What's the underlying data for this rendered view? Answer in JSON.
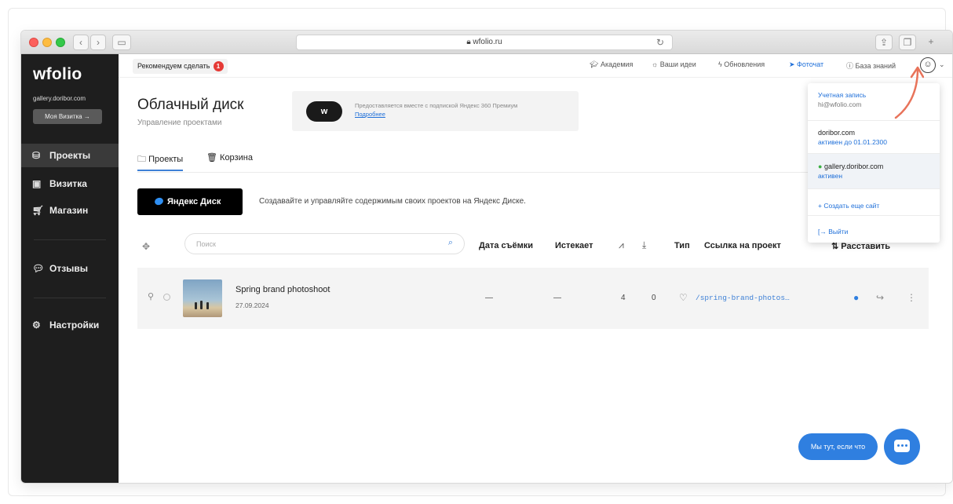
{
  "browser": {
    "url": "wfolio.ru",
    "lock_icon": "lock-icon",
    "nav_back": "‹",
    "nav_forward": "›"
  },
  "sidebar": {
    "logo": "wfolio",
    "domain": "gallery.doribor.com",
    "card_button": "Моя Визитка  →",
    "items": [
      {
        "label": "Проекты",
        "icon": "database-icon",
        "active": true
      },
      {
        "label": "Визитка",
        "icon": "card-icon"
      },
      {
        "label": "Магазин",
        "icon": "cart-icon"
      },
      {
        "label": "Отзывы",
        "icon": "chat-bubbles-icon"
      },
      {
        "label": "Настройки",
        "icon": "gear-icon"
      }
    ]
  },
  "topbar": {
    "recommend_label": "Рекомендуем сделать",
    "recommend_count": "1",
    "links": [
      "Академия",
      "Ваши идеи",
      "Обновления",
      "Фоточат",
      "База знаний"
    ]
  },
  "page": {
    "title": "Облачный диск",
    "subtitle": "Управление проектами",
    "promo_logo": "w",
    "promo_text": "Предоставляется вместе с подпиской Яндекс 360 Премиум",
    "promo_link": "Подробнее",
    "tabs": [
      "Проекты",
      "Корзина"
    ],
    "ydisk_button": "Яндекс Диск",
    "ydisk_desc": "Создавайте и управляйте содержимым своих проектов на Яндекс Диске."
  },
  "table": {
    "search_placeholder": "Поиск",
    "headers": [
      "Дата съёмки",
      "Истекает",
      "Тип",
      "Ссылка на проект"
    ],
    "arrange_label": "⇅ Расставить",
    "rows": [
      {
        "name": "Spring brand photoshoot",
        "date": "27.09.2024",
        "shoot_date": "—",
        "expires": "—",
        "views": "4",
        "downloads": "0",
        "link": "/spring-brand-photos…"
      }
    ]
  },
  "dropdown": {
    "account_label": "Учетная запись",
    "account_email": "hi@wfolio.com",
    "site1_name": "doribor.com",
    "site1_status": "активен до 01.01.2300",
    "site2_name": "gallery.doribor.com",
    "site2_status": "активен",
    "create_site": "Создать еще сайт",
    "logout": "Выйти"
  },
  "chat": {
    "button_label": "Мы тут, если что"
  },
  "colors": {
    "sidebar_bg": "#1e1e1e",
    "accent_blue": "#2f7fe0",
    "badge_red": "#e53935",
    "annotation_arrow": "#e8735a"
  }
}
